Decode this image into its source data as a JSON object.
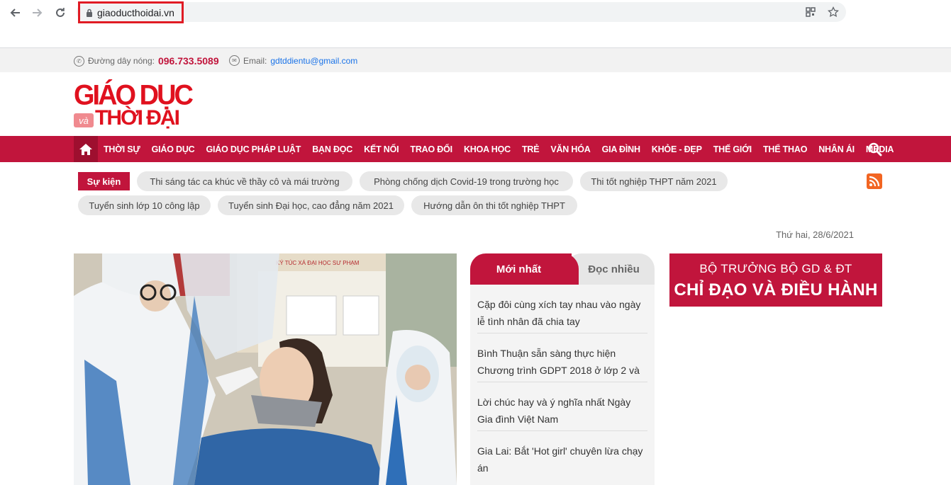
{
  "browser": {
    "url": "giaoducthoidai.vn",
    "back_icon": "arrow-left-icon",
    "forward_icon": "arrow-right-icon",
    "reload_icon": "reload-icon",
    "lock_icon": "lock-icon",
    "qr_icon": "qr-code-icon",
    "star_icon": "star-icon"
  },
  "topbar": {
    "hotline_label": "Đường dây nóng:",
    "hotline_number": "096.733.5089",
    "email_label": "Email:",
    "email_value": "gdtddientu@gmail.com"
  },
  "logo": {
    "line1": "GIÁO DỤC",
    "va": "và",
    "line2": "THỜI ĐẠI"
  },
  "nav": {
    "items": [
      "THỜI SỰ",
      "GIÁO DỤC",
      "GIÁO DỤC PHÁP LUẬT",
      "BẠN ĐỌC",
      "KẾT NỐI",
      "TRAO ĐỔI",
      "KHOA HỌC",
      "TRẺ",
      "VĂN HÓA",
      "GIA ĐÌNH",
      "KHỎE - ĐẸP",
      "THẾ GIỚI",
      "THỂ THAO",
      "NHÂN ÁI",
      "MEDIA"
    ]
  },
  "events": {
    "label": "Sự kiện",
    "tags": [
      "Thi sáng tác ca khúc về thầy cô và mái trường",
      "Phòng chống dịch Covid-19 trong trường học",
      "Thi tốt nghiệp THPT năm 2021",
      "Tuyển sinh lớp 10 công lập",
      "Tuyển sinh Đại học, cao đẳng năm 2021",
      "Hướng dẫn ôn thi tốt nghiệp THPT"
    ]
  },
  "date": "Thứ hai, 28/6/2021",
  "tabs": {
    "latest": "Mới nhất",
    "most_read": "Đọc nhiều"
  },
  "news": [
    "Cặp đôi cùng xích tay nhau vào ngày lễ tình nhân đã chia tay",
    "Bình Thuận sẵn sàng thực hiện Chương trình GDPT 2018 ở lớp 2 và 6",
    "Lời chúc hay và ý nghĩa nhất Ngày Gia đình Việt Nam",
    "Gia Lai: Bắt 'Hot girl' chuyên lừa chạy án"
  ],
  "banner": {
    "line1": "BỘ TRƯỞNG BỘ GD & ĐT",
    "line2": "CHỈ ĐẠO VÀ ĐIỀU HÀNH"
  },
  "hero_sign": "KÝ TÚC XÁ ĐẠI HỌC SƯ PHẠM",
  "colors": {
    "brand": "#c1153c",
    "logo_red": "#e0111e",
    "rss": "#f26522"
  }
}
